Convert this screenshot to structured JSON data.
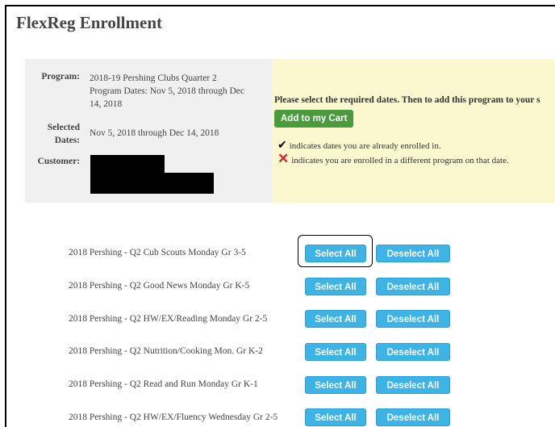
{
  "title": "FlexReg Enrollment",
  "info": {
    "program_label": "Program:",
    "program_line1": "2018-19 Pershing Clubs Quarter 2",
    "program_line2": "Program Dates: Nov 5, 2018 through Dec",
    "program_line3": "14, 2018",
    "selected_label_1": "Selected",
    "selected_label_2": "Dates:",
    "selected_value": "Nov 5, 2018 through Dec 14, 2018",
    "customer_label": "Customer:"
  },
  "notice": {
    "message": "Please select the required dates. Then to add this program to your s",
    "add_to_cart": "Add to my Cart",
    "legend_enrolled": "indicates dates you are already enrolled in.",
    "legend_conflict": "indicates you are enrolled in a different program on that date."
  },
  "buttons": {
    "select_all": "Select All",
    "deselect_all": "Deselect All"
  },
  "programs": [
    "2018 Pershing  - Q2 Cub Scouts Monday Gr 3-5",
    "2018 Pershing  - Q2 Good News Monday Gr K-5",
    "2018 Pershing  - Q2 HW/EX/Reading Monday Gr 2-5",
    "2018 Pershing  - Q2 Nutrition/Cooking Mon. Gr K-2",
    "2018 Pershing  - Q2 Read and Run Monday Gr K-1",
    "2018 Pershing  - Q2 HW/EX/Fluency Wednesday Gr 2-5"
  ],
  "colors": {
    "select_btn": "#3eb3e6",
    "cart_btn": "#4a9b3e",
    "notice_bg": "#fbf8d0",
    "info_bg": "#f0f0f0"
  }
}
